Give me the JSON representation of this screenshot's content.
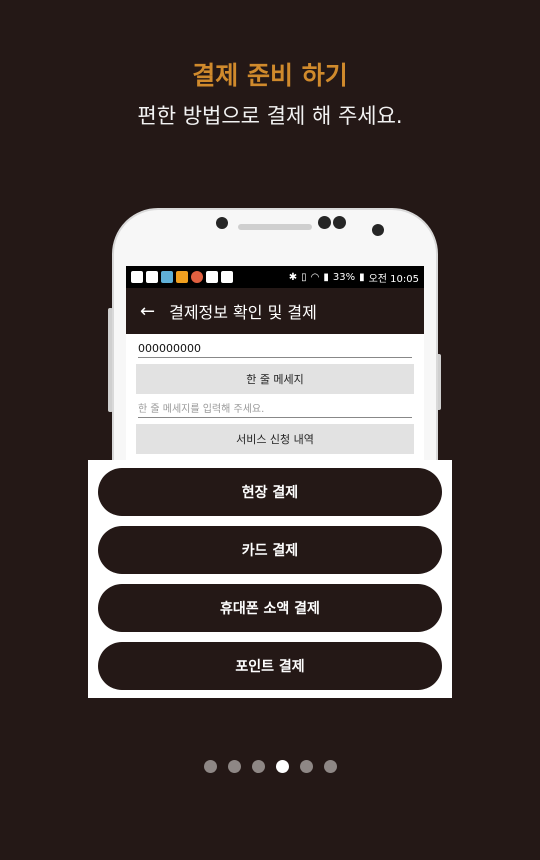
{
  "header": {
    "title": "결제 준비 하기",
    "subtitle": "편한 방법으로 결제 해 주세요."
  },
  "status_bar": {
    "icons": [
      "message-icon",
      "chat-icon",
      "app-icon",
      "app-icon",
      "app-icon",
      "camera-icon",
      "camera-icon",
      "bluetooth-icon",
      "vibrate-icon",
      "wifi-icon",
      "signal-icon"
    ],
    "battery": "33%",
    "time": "오전 10:05"
  },
  "app_bar": {
    "back_icon": "arrow-left-icon",
    "title": "결제정보 확인 및 결제"
  },
  "form": {
    "phone_value": "000000000",
    "message_button": "한 줄 메세지",
    "message_placeholder": "한 줄 메세지를 입력해 주세요.",
    "service_button": "서비스 신청 내역"
  },
  "payment_options": [
    "현장 결제",
    "카드 결제",
    "휴대폰 소액 결제",
    "포인트 결제"
  ],
  "pagination": {
    "total": 6,
    "active_index": 3
  },
  "colors": {
    "background": "#241816",
    "accent": "#d08a2c",
    "button": "#241816"
  }
}
